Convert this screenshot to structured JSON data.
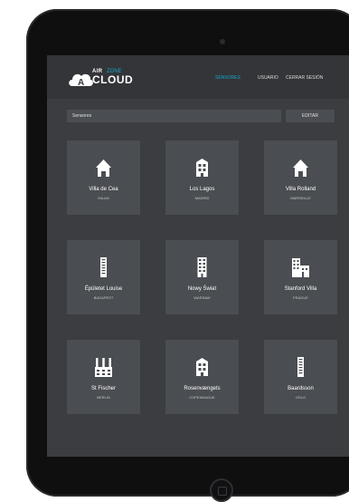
{
  "app": {
    "logo": {
      "air": "AIR",
      "zone": "ZONE",
      "cloud": "CLOUD"
    },
    "nav": [
      {
        "label": "SENSORES",
        "active": true
      },
      {
        "label": "USUARIO",
        "active": false
      },
      {
        "label": "CERRAR SESIÓN",
        "active": false
      }
    ],
    "toolbar": {
      "search_value": "Sensores",
      "edit_label": "EDITAR"
    },
    "colors": {
      "accent": "#1aa3c9",
      "tile": "#4a4d51",
      "screen": "#3b3d40"
    }
  },
  "buildings": [
    {
      "name": "Villa de Cea",
      "city": "MILAN",
      "icon": "house-icon"
    },
    {
      "name": "Los Lagos",
      "city": "MADRID",
      "icon": "building-icon"
    },
    {
      "name": "Villa Rolland",
      "city": "MARSEILLE",
      "icon": "house-icon"
    },
    {
      "name": "Épületet Louise",
      "city": "BUDAPEST",
      "icon": "tower-icon"
    },
    {
      "name": "Nowy Świat",
      "city": "WARSAW",
      "icon": "office-icon"
    },
    {
      "name": "Stanford Villa",
      "city": "PRAGUE",
      "icon": "office-complex-icon"
    },
    {
      "name": "St Fischer",
      "city": "BERLIN",
      "icon": "factory-icon"
    },
    {
      "name": "Rosenvængets",
      "city": "COPENHAGUE",
      "icon": "building-icon"
    },
    {
      "name": "Baardsson",
      "city": "OSLO",
      "icon": "tower-icon"
    }
  ]
}
